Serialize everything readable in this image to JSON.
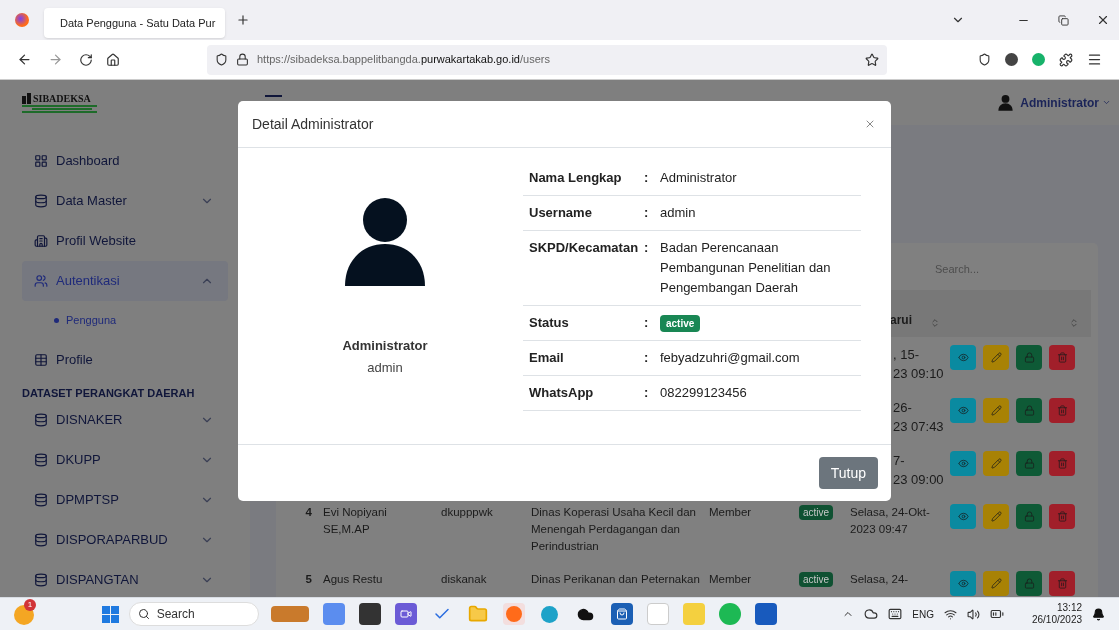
{
  "browser": {
    "tab_title": "Data Pengguna - Satu Data Pur",
    "url_prefix": "https://sibadeksa.bappelitbangda.",
    "url_domain": "purwakartakab.go.id",
    "url_path": "/users"
  },
  "header": {
    "logo": "SIBADEKSA",
    "user": "Administrator"
  },
  "sidebar": {
    "groups": [
      {
        "items": [
          {
            "label": "Dashboard",
            "kind": "grid",
            "selected": false
          },
          {
            "label": "Data Master",
            "kind": "database",
            "selected": false,
            "expanded": false
          },
          {
            "label": "Profil Website",
            "kind": "building",
            "selected": false
          },
          {
            "label": "Autentikasi",
            "kind": "users",
            "selected": true,
            "expanded": true,
            "children": [
              {
                "label": "Pengguna",
                "selected": true
              }
            ]
          },
          {
            "label": "Profile",
            "kind": "table",
            "selected": false
          }
        ]
      },
      {
        "heading": "DATASET PERANGKAT DAERAH",
        "items": [
          {
            "label": "DISNAKER",
            "kind": "database",
            "selected": false,
            "expanded": false
          },
          {
            "label": "DKUPP",
            "kind": "database",
            "selected": false,
            "expanded": false
          },
          {
            "label": "DPMPTSP",
            "kind": "database",
            "selected": false,
            "expanded": false
          },
          {
            "label": "DISPORAPARBUD",
            "kind": "database",
            "selected": false,
            "expanded": false
          },
          {
            "label": "DISPANGTAN",
            "kind": "database",
            "selected": false,
            "expanded": false
          }
        ]
      }
    ]
  },
  "table": {
    "search_placeholder": "Search...",
    "date_heading": "arui",
    "actions": [
      {
        "kind": "view"
      },
      {
        "kind": "edit"
      },
      {
        "kind": "password"
      },
      {
        "kind": "delete"
      }
    ],
    "rows": [
      {
        "kind": "partial",
        "date_lines": [
          ", 15-",
          "23 09:10"
        ]
      },
      {
        "kind": "partial",
        "date_lines": [
          "26-",
          "23 07:43"
        ]
      },
      {
        "kind": "partial",
        "date_lines": [
          "7-",
          "23 09:00"
        ]
      },
      {
        "kind": "full",
        "number": "4",
        "name": "Evi Nopiyani SE,M.AP",
        "username": "dkupppwk",
        "skpd": "Dinas Koperasi Usaha Kecil dan Menengah Perdagangan dan Perindustrian",
        "role": "Member",
        "status": "active",
        "date": "Selasa, 24-Okt-2023 09:47"
      },
      {
        "kind": "full",
        "number": "5",
        "name": "Agus Restu",
        "username": "diskanak",
        "skpd": "Dinas Perikanan dan Peternakan",
        "role": "Member",
        "status": "active",
        "date": "Selasa, 24-"
      }
    ]
  },
  "modal": {
    "title": "Detail Administrator",
    "name": "Administrator",
    "username": "admin",
    "separator": ":",
    "fields": [
      {
        "label": "Nama Lengkap",
        "value": "Administrator"
      },
      {
        "label": "Username",
        "value": "admin"
      },
      {
        "label": "SKPD/Kecamatan",
        "value": "Badan Perencanaan Pembangunan Penelitian dan Pengembangan Daerah"
      },
      {
        "label": "Status",
        "value": "active",
        "kind": "badge"
      },
      {
        "label": "Email",
        "value": "febyadzuhri@gmail.com"
      },
      {
        "label": "WhatsApp",
        "value": "082299123456"
      }
    ],
    "close_button": "Tutup"
  },
  "taskbar": {
    "notification_count": "1",
    "search_placeholder": "Search",
    "language": "ENG",
    "time": "13:12",
    "date": "26/10/2023"
  }
}
